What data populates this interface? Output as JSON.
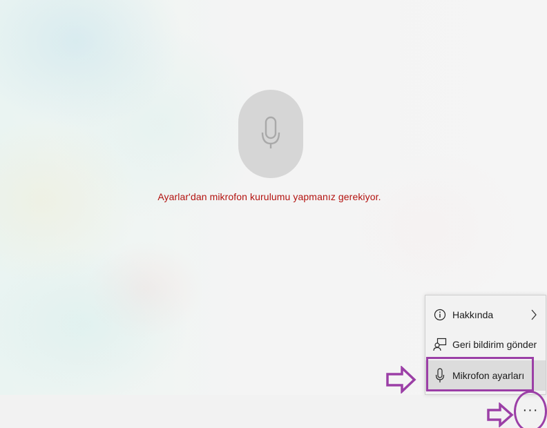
{
  "status": {
    "message": "Ayarlar'dan mikrofon kurulumu yapmanız gerekiyor.",
    "message_color": "#b3120f",
    "mic_icon": "microphone-icon"
  },
  "menu": {
    "items": [
      {
        "label": "Hakkında",
        "icon": "info-icon",
        "has_submenu": true
      },
      {
        "label": "Geri bildirim gönder",
        "icon": "feedback-icon",
        "has_submenu": false
      },
      {
        "label": "Mikrofon ayarları",
        "icon": "microphone-icon",
        "has_submenu": false
      }
    ]
  },
  "toolbar": {
    "more_label": "···",
    "more_icon": "more-options-icon"
  },
  "annotations": {
    "color": "#9b3fa6",
    "arrow_icon": "outline-arrow-right-icon"
  }
}
